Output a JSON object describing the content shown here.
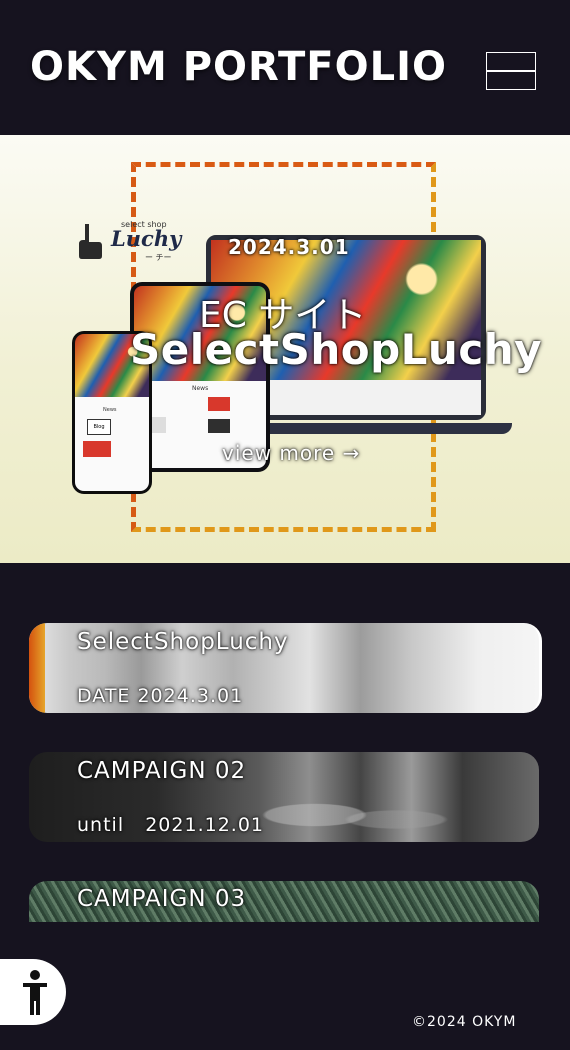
{
  "header": {
    "site_title": "OKYM PORTFOLIO",
    "menu_icon": "hamburger-menu-icon"
  },
  "hero": {
    "date": "2024.3.01",
    "category": "EC サイト",
    "title": "SelectShopLuchy",
    "view_more": "view more →",
    "brand": {
      "small_text": "select shop",
      "name": "Luchy",
      "kana": "ー チー"
    },
    "device_site_labels": {
      "news": "News",
      "blog": "Blog"
    },
    "colors": {
      "dash_orange": "#d95b14",
      "dash_gold": "#e0981a",
      "background": "#f1f0d4"
    }
  },
  "works": [
    {
      "title": "SelectShopLuchy",
      "date": "DATE 2024.3.01"
    },
    {
      "title": "CAMPAIGN 02",
      "date": "until   2021.12.01"
    },
    {
      "title": "CAMPAIGN 03"
    }
  ],
  "footer": {
    "accessibility_icon": "accessibility-person-icon",
    "copyright": "©2024 OKYM"
  },
  "colors": {
    "page_background": "#16131f",
    "text": "#ffffff"
  }
}
